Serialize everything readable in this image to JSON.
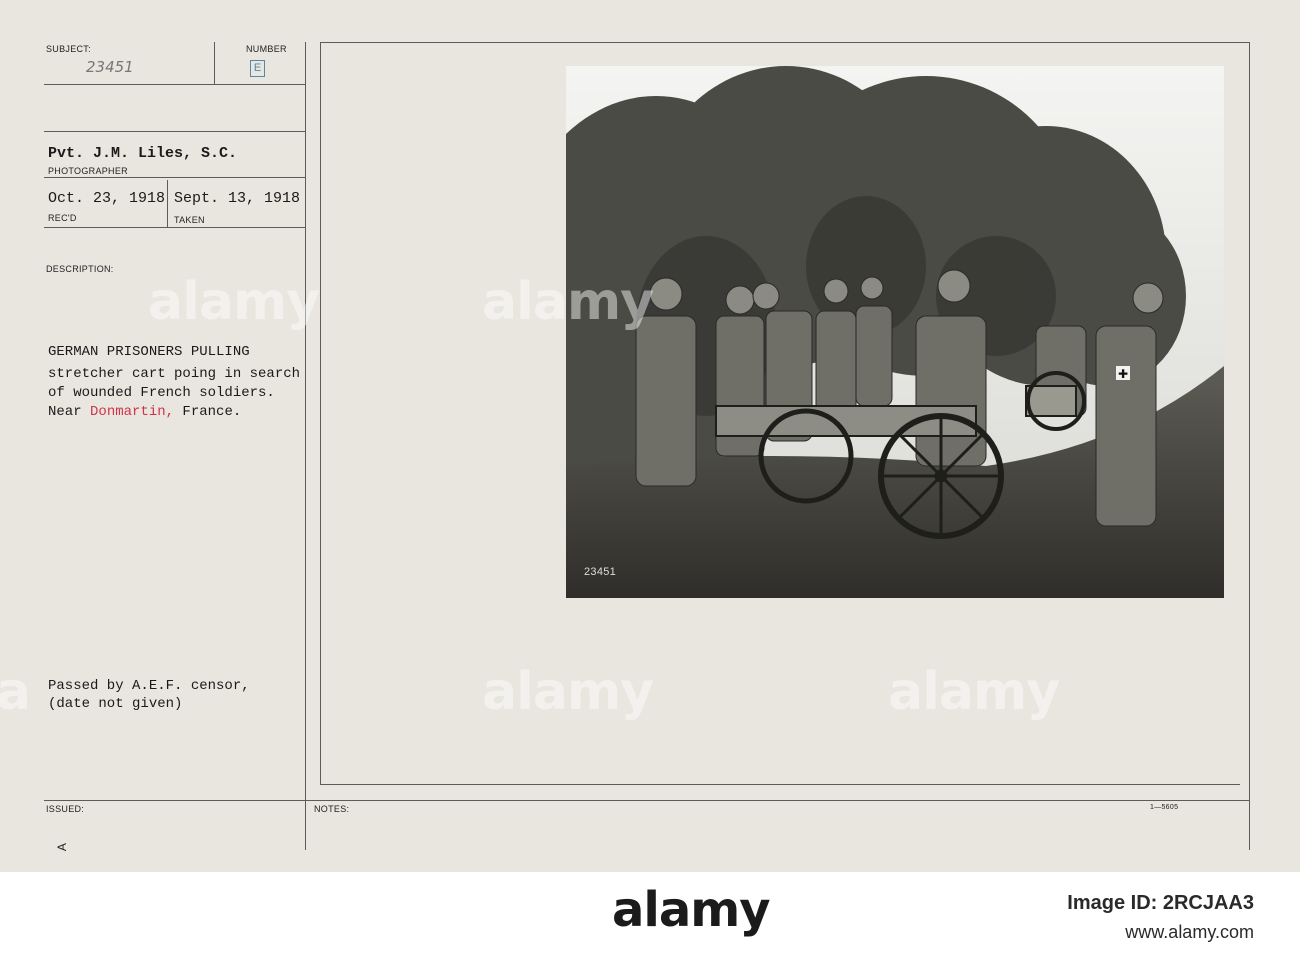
{
  "card": {
    "subject_label": "SUBJECT:",
    "subject_value": "23451",
    "number_label": "NUMBER",
    "number_value": "E",
    "photographer_value": "Pvt. J.M. Liles, S.C.",
    "photographer_label": "PHOTOGRAPHER",
    "recd_value": "Oct. 23, 1918",
    "recd_label": "REC'D",
    "taken_value": "Sept. 13, 1918",
    "taken_label": "TAKEN",
    "description_label": "DESCRIPTION:",
    "description_lines": [
      "GERMAN PRISONERS PULLING",
      "stretcher cart poing in search",
      "of wounded French soldiers."
    ],
    "location_prefix": "Near ",
    "location_place": "Donmartin,",
    "location_suffix": " France.",
    "censor_lines": [
      "Passed by A.E.F. censor,",
      "(date not given)"
    ],
    "issued_label": "ISSUED:",
    "issued_mark": "A",
    "notes_label": "NOTES:",
    "form_number": "1—5605",
    "photo_caption_number": "23451"
  },
  "watermarks": [
    "alamy",
    "alamy",
    "alamy",
    "alamy",
    "a"
  ],
  "footer": {
    "logo": "alamy",
    "image_id_label": "Image ID: 2RCJAA3",
    "site": "www.alamy.com"
  },
  "colors": {
    "paper": "#e9e6df",
    "ink": "#1a1a1a",
    "red_stamp": "#d0324a",
    "strip": "#ffffff"
  }
}
